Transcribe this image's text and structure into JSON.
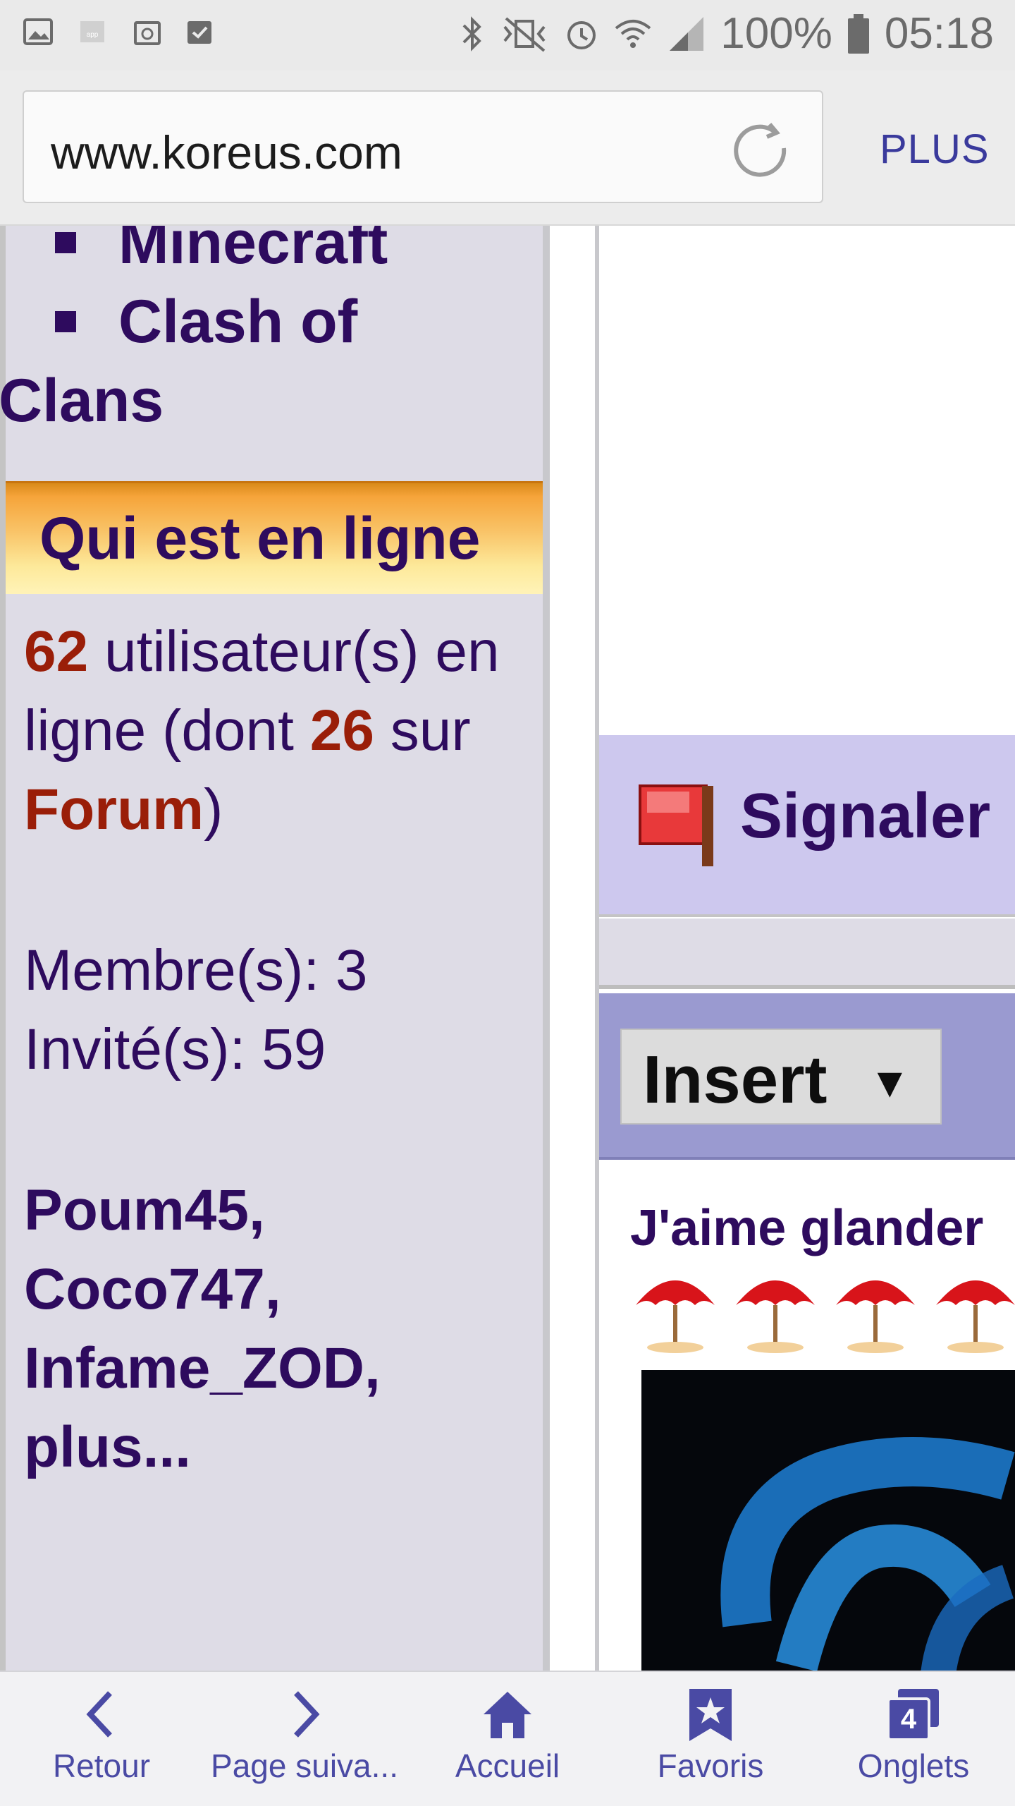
{
  "status_bar": {
    "battery": "100%",
    "time": "05:18"
  },
  "browser": {
    "url": "www.koreus.com",
    "menu_label": "PLUS"
  },
  "sidebar": {
    "nav_items": [
      {
        "label": "Minecraft"
      },
      {
        "label": "Clash of Clans"
      }
    ],
    "who_online_title": "Qui est en ligne",
    "online": {
      "count": "62",
      "text1": " utilisateur(s) en ligne (dont ",
      "forum_count": "26",
      "text2": " sur ",
      "forum_label": "Forum",
      "text3": ")"
    },
    "members": "Membre(s): 3",
    "guests": "Invité(s): 59",
    "users": [
      "Poum45,",
      "Coco747,",
      "Infame_ZOD,",
      "plus..."
    ]
  },
  "right_panel": {
    "report_label": "Signaler",
    "insert_label": "Insert",
    "insert_arrow": "▼",
    "mood_text": "J'aime glander",
    "umbrella_count": 4
  },
  "toolbar": {
    "items": [
      {
        "label": "Retour",
        "icon": "back-chevron-icon"
      },
      {
        "label": "Page suiva...",
        "icon": "forward-chevron-icon"
      },
      {
        "label": "Accueil",
        "icon": "home-icon"
      },
      {
        "label": "Favoris",
        "icon": "bookmark-star-icon"
      },
      {
        "label": "Onglets",
        "icon": "tabs-icon",
        "badge": "4"
      }
    ]
  },
  "colors": {
    "accent": "#4a4aa4",
    "text_purple": "#2e0b5e",
    "highlight_red": "#9a1e08"
  }
}
